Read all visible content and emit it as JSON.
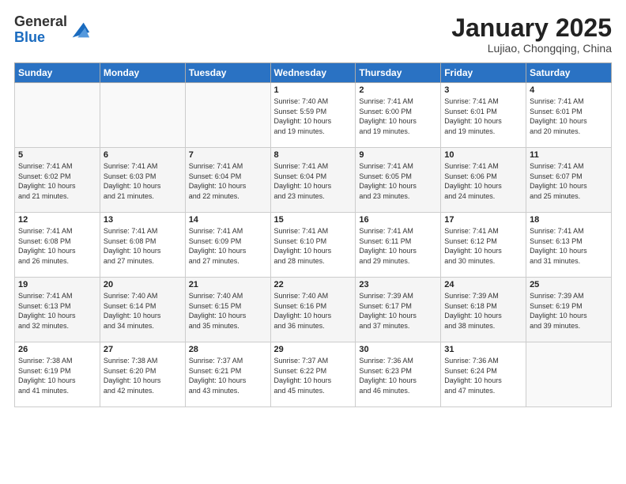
{
  "header": {
    "logo_line1": "General",
    "logo_line2": "Blue",
    "title": "January 2025",
    "location": "Lujiao, Chongqing, China"
  },
  "weekdays": [
    "Sunday",
    "Monday",
    "Tuesday",
    "Wednesday",
    "Thursday",
    "Friday",
    "Saturday"
  ],
  "weeks": [
    [
      {
        "day": "",
        "info": ""
      },
      {
        "day": "",
        "info": ""
      },
      {
        "day": "",
        "info": ""
      },
      {
        "day": "1",
        "info": "Sunrise: 7:40 AM\nSunset: 5:59 PM\nDaylight: 10 hours\nand 19 minutes."
      },
      {
        "day": "2",
        "info": "Sunrise: 7:41 AM\nSunset: 6:00 PM\nDaylight: 10 hours\nand 19 minutes."
      },
      {
        "day": "3",
        "info": "Sunrise: 7:41 AM\nSunset: 6:01 PM\nDaylight: 10 hours\nand 19 minutes."
      },
      {
        "day": "4",
        "info": "Sunrise: 7:41 AM\nSunset: 6:01 PM\nDaylight: 10 hours\nand 20 minutes."
      }
    ],
    [
      {
        "day": "5",
        "info": "Sunrise: 7:41 AM\nSunset: 6:02 PM\nDaylight: 10 hours\nand 21 minutes."
      },
      {
        "day": "6",
        "info": "Sunrise: 7:41 AM\nSunset: 6:03 PM\nDaylight: 10 hours\nand 21 minutes."
      },
      {
        "day": "7",
        "info": "Sunrise: 7:41 AM\nSunset: 6:04 PM\nDaylight: 10 hours\nand 22 minutes."
      },
      {
        "day": "8",
        "info": "Sunrise: 7:41 AM\nSunset: 6:04 PM\nDaylight: 10 hours\nand 23 minutes."
      },
      {
        "day": "9",
        "info": "Sunrise: 7:41 AM\nSunset: 6:05 PM\nDaylight: 10 hours\nand 23 minutes."
      },
      {
        "day": "10",
        "info": "Sunrise: 7:41 AM\nSunset: 6:06 PM\nDaylight: 10 hours\nand 24 minutes."
      },
      {
        "day": "11",
        "info": "Sunrise: 7:41 AM\nSunset: 6:07 PM\nDaylight: 10 hours\nand 25 minutes."
      }
    ],
    [
      {
        "day": "12",
        "info": "Sunrise: 7:41 AM\nSunset: 6:08 PM\nDaylight: 10 hours\nand 26 minutes."
      },
      {
        "day": "13",
        "info": "Sunrise: 7:41 AM\nSunset: 6:08 PM\nDaylight: 10 hours\nand 27 minutes."
      },
      {
        "day": "14",
        "info": "Sunrise: 7:41 AM\nSunset: 6:09 PM\nDaylight: 10 hours\nand 27 minutes."
      },
      {
        "day": "15",
        "info": "Sunrise: 7:41 AM\nSunset: 6:10 PM\nDaylight: 10 hours\nand 28 minutes."
      },
      {
        "day": "16",
        "info": "Sunrise: 7:41 AM\nSunset: 6:11 PM\nDaylight: 10 hours\nand 29 minutes."
      },
      {
        "day": "17",
        "info": "Sunrise: 7:41 AM\nSunset: 6:12 PM\nDaylight: 10 hours\nand 30 minutes."
      },
      {
        "day": "18",
        "info": "Sunrise: 7:41 AM\nSunset: 6:13 PM\nDaylight: 10 hours\nand 31 minutes."
      }
    ],
    [
      {
        "day": "19",
        "info": "Sunrise: 7:41 AM\nSunset: 6:13 PM\nDaylight: 10 hours\nand 32 minutes."
      },
      {
        "day": "20",
        "info": "Sunrise: 7:40 AM\nSunset: 6:14 PM\nDaylight: 10 hours\nand 34 minutes."
      },
      {
        "day": "21",
        "info": "Sunrise: 7:40 AM\nSunset: 6:15 PM\nDaylight: 10 hours\nand 35 minutes."
      },
      {
        "day": "22",
        "info": "Sunrise: 7:40 AM\nSunset: 6:16 PM\nDaylight: 10 hours\nand 36 minutes."
      },
      {
        "day": "23",
        "info": "Sunrise: 7:39 AM\nSunset: 6:17 PM\nDaylight: 10 hours\nand 37 minutes."
      },
      {
        "day": "24",
        "info": "Sunrise: 7:39 AM\nSunset: 6:18 PM\nDaylight: 10 hours\nand 38 minutes."
      },
      {
        "day": "25",
        "info": "Sunrise: 7:39 AM\nSunset: 6:19 PM\nDaylight: 10 hours\nand 39 minutes."
      }
    ],
    [
      {
        "day": "26",
        "info": "Sunrise: 7:38 AM\nSunset: 6:19 PM\nDaylight: 10 hours\nand 41 minutes."
      },
      {
        "day": "27",
        "info": "Sunrise: 7:38 AM\nSunset: 6:20 PM\nDaylight: 10 hours\nand 42 minutes."
      },
      {
        "day": "28",
        "info": "Sunrise: 7:37 AM\nSunset: 6:21 PM\nDaylight: 10 hours\nand 43 minutes."
      },
      {
        "day": "29",
        "info": "Sunrise: 7:37 AM\nSunset: 6:22 PM\nDaylight: 10 hours\nand 45 minutes."
      },
      {
        "day": "30",
        "info": "Sunrise: 7:36 AM\nSunset: 6:23 PM\nDaylight: 10 hours\nand 46 minutes."
      },
      {
        "day": "31",
        "info": "Sunrise: 7:36 AM\nSunset: 6:24 PM\nDaylight: 10 hours\nand 47 minutes."
      },
      {
        "day": "",
        "info": ""
      }
    ]
  ]
}
